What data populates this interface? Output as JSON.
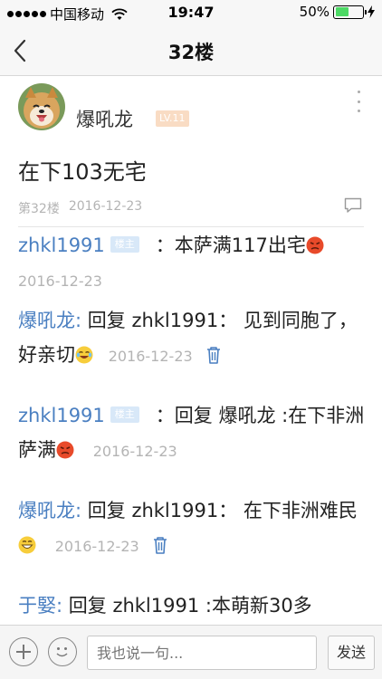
{
  "status_bar": {
    "carrier": "中国移动",
    "time": "19:47",
    "battery_percent": "50%",
    "battery_level": 0.5,
    "battery_color": "#4cd964"
  },
  "nav": {
    "title": "32楼",
    "back_icon": "chevron-left-icon"
  },
  "post": {
    "author": "爆吼龙",
    "level": "LV.11",
    "content": "在下103无宅",
    "floor": "第32楼",
    "date": "2016-12-23"
  },
  "replies": [
    {
      "name": "zhkl1991",
      "owner_tag": "楼主",
      "text": "：本萨满117出宅",
      "emoji": "angry-emoji",
      "date": "2016-12-23"
    },
    {
      "name": "爆吼龙:",
      "text": "回复 zhkl1991： 见到同胞了，好亲切",
      "emoji": "laugh-cry-emoji",
      "date": "2016-12-23",
      "deletable": true
    },
    {
      "name": "zhkl1991",
      "owner_tag": "楼主",
      "text": "：回复 爆吼龙 :在下非洲萨满",
      "emoji": "angry-emoji",
      "date": "2016-12-23"
    },
    {
      "name": "爆吼龙:",
      "text": "回复 zhkl1991： 在下非洲难民",
      "emoji": "grin-emoji",
      "date": "2016-12-23",
      "deletable": true
    },
    {
      "name": "于婜:",
      "text": "回复 zhkl1991 :本萌新30多"
    }
  ],
  "input_bar": {
    "placeholder": "我也说一句...",
    "send_label": "发送"
  },
  "colors": {
    "link_blue": "#4a7fc1",
    "meta_gray": "#b4b4b4",
    "owner_tag_bg": "#d8e8f8"
  }
}
